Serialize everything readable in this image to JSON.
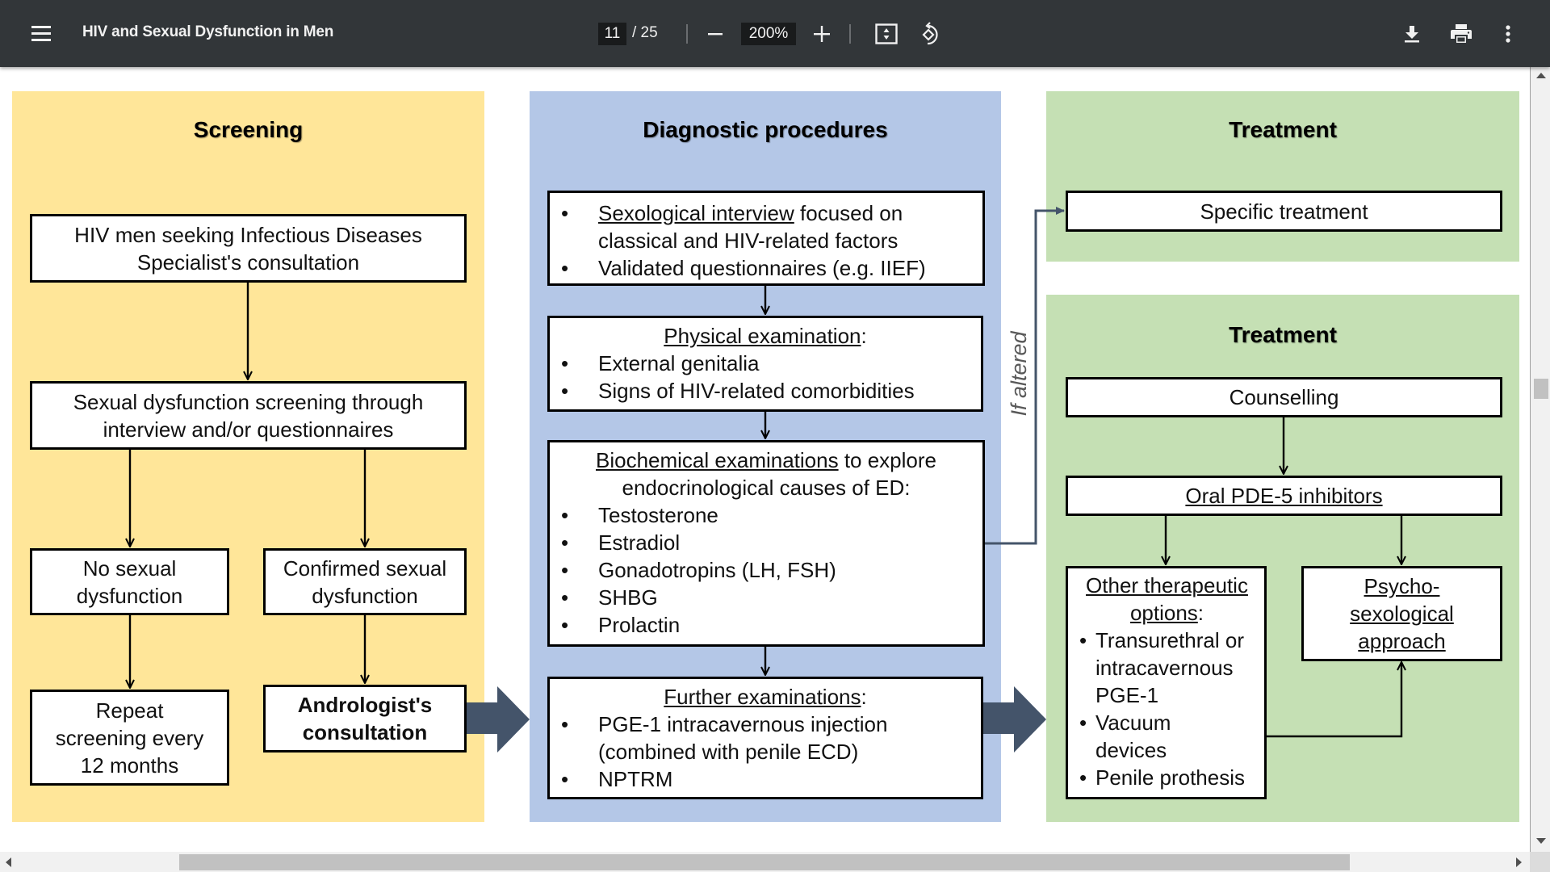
{
  "toolbar": {
    "title": "HIV and Sexual Dysfunction in Men",
    "current_page": "11",
    "total_pages": "/ 25",
    "zoom_level": "200%",
    "icons": {
      "menu": "menu-icon",
      "zoom_out": "minus-icon",
      "zoom_in": "plus-icon",
      "fit": "fit-to-page-icon",
      "rotate": "rotate-counterclockwise-icon",
      "download": "download-icon",
      "print": "print-icon",
      "more": "more-vert-icon"
    }
  },
  "colors": {
    "toolbar_bg": "#323639",
    "screening_panel": "#FFE699",
    "diagnostic_panel": "#B4C7E7",
    "treatment_panel": "#C5E0B4",
    "big_arrow": "#44546A"
  },
  "diagram": {
    "screening": {
      "title": "Screening",
      "box_start": "HIV men seeking Infectious Diseases Specialist's consultation",
      "box_screening": "Sexual dysfunction screening through interview and/or questionnaires",
      "box_no_dysfunction": "No sexual dysfunction",
      "box_confirmed": "Confirmed sexual dysfunction",
      "box_repeat": "Repeat screening every 12 months",
      "box_andrologist": "Andrologist's consultation"
    },
    "diagnostic": {
      "title": "Diagnostic procedures",
      "interview": {
        "item1_underlined": "Sexological interview",
        "item1_rest": " focused on classical and HIV-related factors",
        "item2": "Validated questionnaires (e.g. IIEF)"
      },
      "physical": {
        "heading": "Physical examination",
        "heading_suffix": ":",
        "items": [
          "External genitalia",
          "Signs of HIV-related comorbidities"
        ]
      },
      "biochemical": {
        "heading_underlined": "Biochemical examinations",
        "heading_rest": " to explore endocrinological causes of ED:",
        "items": [
          "Testosterone",
          "Estradiol",
          "Gonadotropins (LH, FSH)",
          "SHBG",
          "Prolactin"
        ]
      },
      "further": {
        "heading": "Further examinations",
        "heading_suffix": ":",
        "items": [
          "PGE-1 intracavernous injection (combined with penile ECD)",
          "NPTRM"
        ]
      },
      "if_altered_label": "If altered"
    },
    "treatment_specific": {
      "title": "Treatment",
      "box": "Specific treatment"
    },
    "treatment_main": {
      "title": "Treatment",
      "counselling": "Counselling",
      "oral": "Oral PDE-5 inhibitors",
      "other_heading": "Other therapeutic options",
      "other_suffix": ":",
      "other_items": [
        "Transurethral or intracavernous PGE-1",
        "Vacuum devices",
        "Penile prothesis"
      ],
      "psycho": "Psycho-sexological approach"
    }
  }
}
